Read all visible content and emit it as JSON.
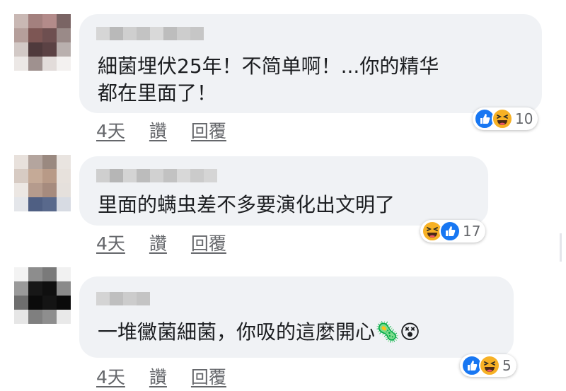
{
  "comments": [
    {
      "text_line1": "細菌埋伏25年！不简单啊！...你的精华",
      "text_line2": "都在里面了！",
      "time": "4天",
      "like_label": "讚",
      "reply_label": "回覆",
      "reaction_count": "10",
      "reactions": [
        "like-icon",
        "haha-icon"
      ]
    },
    {
      "text_line1": "里面的螨虫差不多要演化出文明了",
      "time": "4天",
      "like_label": "讚",
      "reply_label": "回覆",
      "reaction_count": "17",
      "reactions": [
        "haha-icon",
        "like-icon"
      ]
    },
    {
      "text_line1": "一堆黴菌細菌，你吸的這麼開心🦠😵",
      "time": "4天",
      "like_label": "讚",
      "reply_label": "回覆",
      "reaction_count": "5",
      "reactions": [
        "like-icon",
        "haha-icon"
      ]
    }
  ],
  "colors": {
    "bubble": "#f0f2f5",
    "like_blue": "#1877f2",
    "haha_yellow": "#f7b125",
    "action_gray": "#65676b"
  }
}
